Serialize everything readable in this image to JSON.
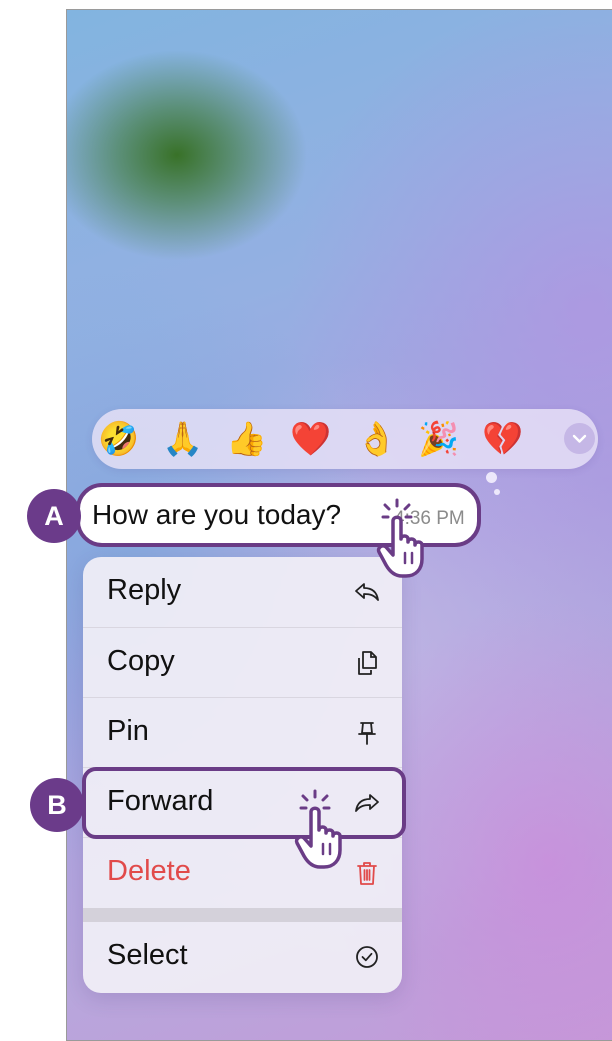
{
  "reactions": {
    "emojis": [
      "🤣",
      "🙏",
      "👍",
      "❤️",
      "👌",
      "🎉",
      "💔"
    ],
    "more_icon": "chevron-down-icon"
  },
  "message": {
    "text": "How are you today?",
    "time": "4:36 PM"
  },
  "context_menu": {
    "items": [
      {
        "label": "Reply",
        "icon": "reply-icon"
      },
      {
        "label": "Copy",
        "icon": "copy-icon"
      },
      {
        "label": "Pin",
        "icon": "pin-icon"
      },
      {
        "label": "Forward",
        "icon": "forward-icon"
      },
      {
        "label": "Delete",
        "icon": "trash-icon"
      },
      {
        "label": "Select",
        "icon": "check-circle-icon"
      }
    ]
  },
  "callouts": [
    {
      "label": "A"
    },
    {
      "label": "B"
    }
  ],
  "colors": {
    "callout": "#6b3b8a",
    "delete": "#e14a4a",
    "reaction_more": "#c5b7e6"
  }
}
